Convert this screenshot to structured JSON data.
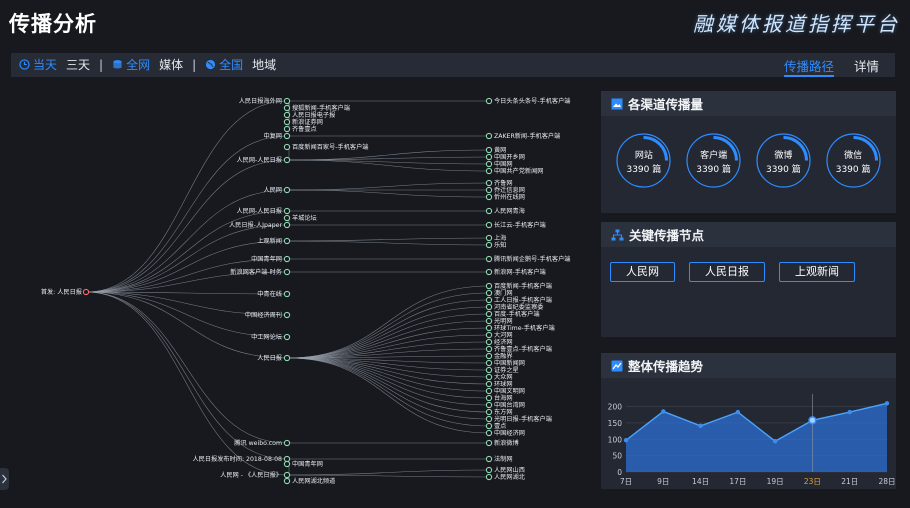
{
  "header": {
    "title": "传播分析",
    "brand": "融媒体报道指挥平台"
  },
  "filters": {
    "time": {
      "active": "当天",
      "other": "三天"
    },
    "scope": {
      "active": "全网",
      "other": "媒体"
    },
    "region": {
      "active": "全国",
      "other": "地域"
    },
    "separator": "|"
  },
  "tabs": [
    {
      "label": "传播路径",
      "active": true
    },
    {
      "label": "详情",
      "active": false
    }
  ],
  "tree": {
    "root": "首发: 人民日报",
    "level1": [
      "人民日报海外网",
      "中复网",
      "人民网-人民日报",
      "人民网",
      "人民网-人民日报",
      "人民日报-人Jpaper",
      "上观新闻",
      "中国青年网",
      "新浪网客户端-时务",
      "中青在线",
      "中国经济周刊",
      "中工网论坛",
      "人民日报",
      "腾讯 weibo.com",
      "人民日报发布时间: 2018-08-08",
      "人民网 - 《人民日报》"
    ],
    "level2": [
      "搜狐新闻-手机客户端",
      "人民日报电子报",
      "新浪证券网",
      "齐鲁壹点",
      "百度新闻百家号-手机客户端",
      "羊城论坛",
      "中国青年网",
      "人民网湖北频道"
    ],
    "level3": [
      "今日头条头条号-手机客户端",
      "ZAKER新闻-手机客户端",
      "黄网",
      "中国开乡网",
      "中国网",
      "中国共产党新闻网",
      "齐鲁网",
      "乔迁信息网",
      "忻州在线网",
      "人民网青海",
      "长江云-手机客户端",
      "上海",
      "乐知",
      "腾讯新闻企鹅号-手机客户端",
      "新浪网-手机客户端",
      "百度新闻-手机客户端",
      "澳门网",
      "工人日报-手机客户端",
      "河南省纪委监察委",
      "百度-手机客户端",
      "光明网",
      "环球Time-手机客户端",
      "大河网",
      "经济网",
      "齐鲁壹点-手机客户端",
      "金融界",
      "中国新闻网",
      "证券之星",
      "大众网",
      "环球网",
      "中国文明网",
      "台海网",
      "中国台湾网",
      "东方网",
      "光明日报-手机客户端",
      "壹点",
      "中国经济网",
      "新浪微博",
      "法制网",
      "人民网山西",
      "人民网湖北"
    ]
  },
  "panels": {
    "channels": {
      "title": "各渠道传播量",
      "items": [
        {
          "name": "网站",
          "value": "3390 篇",
          "ratio": 0.25
        },
        {
          "name": "客户端",
          "value": "3390 篇",
          "ratio": 0.25
        },
        {
          "name": "微博",
          "value": "3390 篇",
          "ratio": 0.25
        },
        {
          "name": "微信",
          "value": "3390 篇",
          "ratio": 0.25
        }
      ]
    },
    "key_nodes": {
      "title": "关键传播节点",
      "items": [
        "人民网",
        "人民日报",
        "上观新闻"
      ]
    },
    "trend": {
      "title": "整体传播趋势"
    }
  },
  "colors": {
    "accent": "#2f8cff",
    "panel": "#232833",
    "panel_head": "#2b313d",
    "highlight_tick": "#e6a23c"
  },
  "chart_data": {
    "type": "area",
    "x": [
      "7日",
      "8日",
      "9日",
      "10日",
      "11日",
      "12日",
      "13日",
      "14日",
      "15日",
      "16日",
      "17日",
      "18日",
      "19日",
      "20日",
      "21日",
      "22日",
      "23日",
      "24日",
      "25日",
      "26日",
      "27日",
      "28日"
    ],
    "x_ticks": [
      "7日",
      "9日",
      "14日",
      "17日",
      "19日",
      "23日",
      "21日",
      "28日"
    ],
    "highlight_tick": "23日",
    "values": [
      97,
      185,
      141,
      183,
      94,
      158,
      183,
      210
    ],
    "yticks": [
      0,
      50,
      100,
      150,
      200
    ],
    "ylim": [
      0,
      220
    ],
    "grid": true
  }
}
